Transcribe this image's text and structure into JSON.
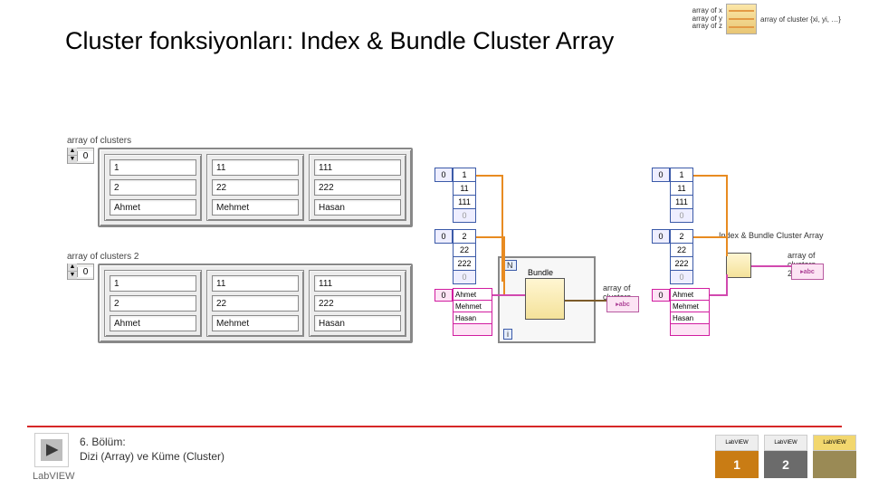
{
  "main_title": "Cluster fonksiyonları: Index & Bundle Cluster Array",
  "vi_icon": {
    "l1": "array of x",
    "l2": "array of y",
    "l3": "array of z",
    "out": "array of cluster {xi, yi, …}"
  },
  "footer": {
    "line1": "6. Bölüm:",
    "line2": "Dizi (Array) ve Küme (Cluster)",
    "wordmark": "LabVIEW"
  },
  "stamps": {
    "s1": "1",
    "s2": "2",
    "s3": "",
    "label": "LabVIEW"
  },
  "panel1": {
    "label": "array of clusters",
    "idx": "0",
    "cells": [
      {
        "a": "1",
        "b": "2",
        "c": "Ahmet"
      },
      {
        "a": "11",
        "b": "22",
        "c": "Mehmet"
      },
      {
        "a": "111",
        "b": "222",
        "c": "Hasan"
      }
    ]
  },
  "panel2": {
    "label": "array of clusters 2",
    "idx": "0",
    "cells": [
      {
        "a": "1",
        "b": "2",
        "c": "Ahmet"
      },
      {
        "a": "11",
        "b": "22",
        "c": "Mehmet"
      },
      {
        "a": "111",
        "b": "222",
        "c": "Hasan"
      }
    ]
  },
  "diagA": {
    "arr1_idx": "0",
    "arr1": [
      "1",
      "11",
      "111",
      "0"
    ],
    "arr2_idx": "0",
    "arr2": [
      "2",
      "22",
      "222",
      "0"
    ],
    "arr3_idx": "0",
    "arr3": [
      "Ahmet",
      "Mehmet",
      "Hasan",
      ""
    ],
    "bundle": "Bundle",
    "outlabel": "array of clusters",
    "n": "N",
    "i": "i"
  },
  "diagB": {
    "arr1_idx": "0",
    "arr1": [
      "1",
      "11",
      "111",
      "0"
    ],
    "arr2_idx": "0",
    "arr2": [
      "2",
      "22",
      "222",
      "0"
    ],
    "arr3_idx": "0",
    "arr3": [
      "Ahmet",
      "Mehmet",
      "Hasan",
      ""
    ],
    "fn": "Index & Bundle Cluster Array",
    "outlabel": "array of clusters 2"
  }
}
